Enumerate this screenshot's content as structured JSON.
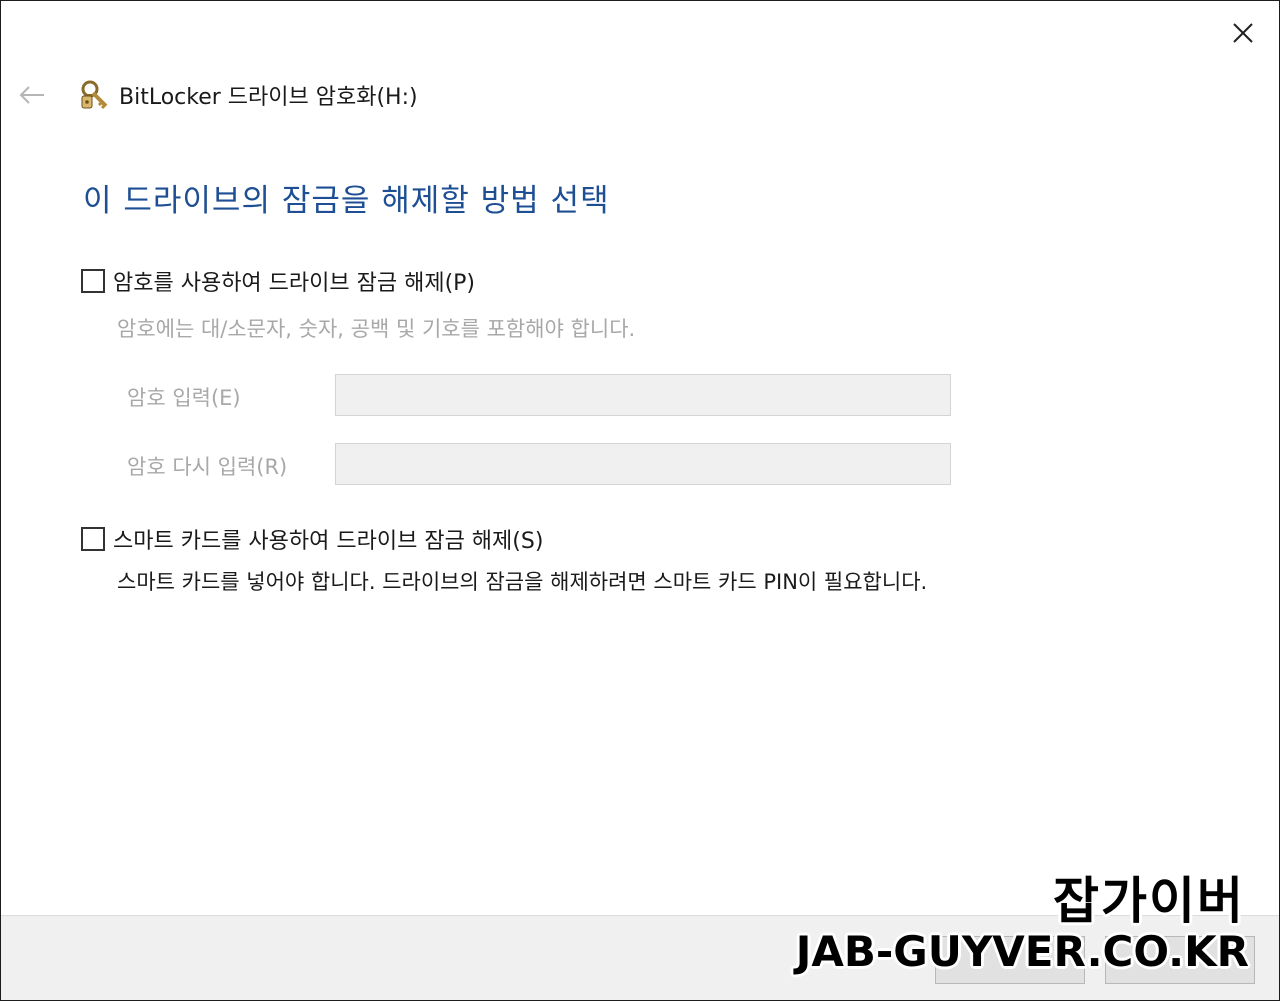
{
  "window": {
    "app_title": "BitLocker 드라이브 암호화(H:)",
    "app_icon": "bitlocker-key-icon",
    "back_icon": "back-arrow-icon",
    "close_icon": "close-icon"
  },
  "main": {
    "heading": "이 드라이브의 잠금을 해제할 방법 선택",
    "heading_color": "#1e4f94",
    "password_option": {
      "label": "암호를 사용하여 드라이브 잠금 해제(P)",
      "checked": false,
      "description": "암호에는 대/소문자, 숫자, 공백 및 기호를 포함해야 합니다.",
      "enter_label": "암호 입력(E)",
      "enter_value": "",
      "reenter_label": "암호 다시 입력(R)",
      "reenter_value": ""
    },
    "smartcard_option": {
      "label": "스마트 카드를 사용하여 드라이브 잠금 해제(S)",
      "checked": false,
      "description": "스마트 카드를 넣어야 합니다. 드라이브의 잠금을 해제하려면 스마트 카드 PIN이 필요합니다."
    }
  },
  "watermark": {
    "korean": "잡가이버",
    "english": "JAB-GUYVER.CO.KR"
  }
}
